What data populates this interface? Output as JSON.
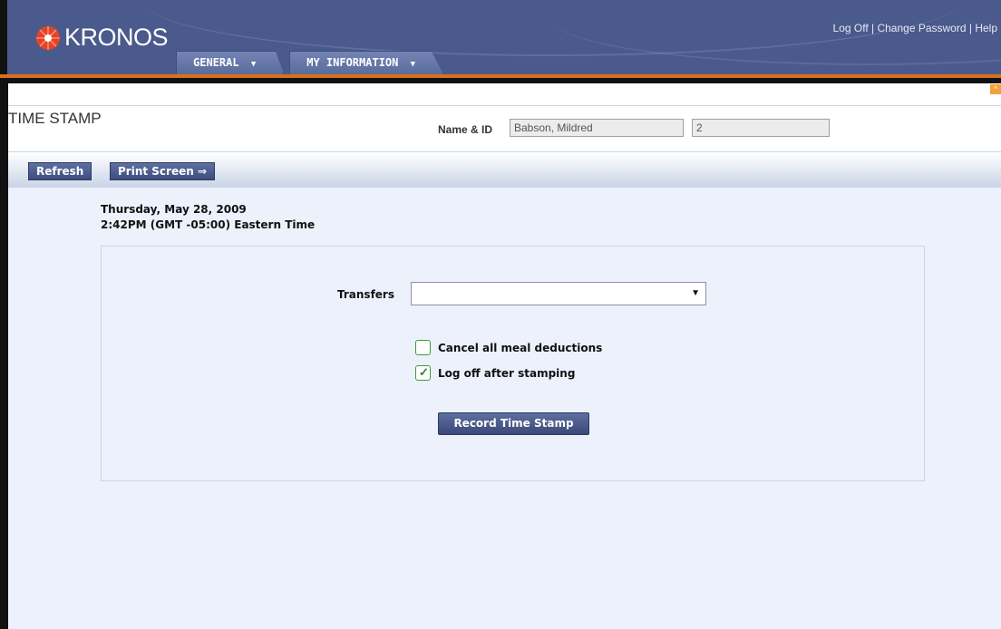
{
  "header": {
    "logo_text": "KRONOS",
    "links": [
      "Log Off",
      "Change Password",
      "Help"
    ],
    "tabs": [
      {
        "label": "GENERAL"
      },
      {
        "label": "MY INFORMATION"
      }
    ]
  },
  "page": {
    "title": "TIME STAMP",
    "name_label": "Name & ID",
    "name_value": "Babson, Mildred",
    "id_value": "2"
  },
  "toolbar": {
    "refresh_label": "Refresh",
    "print_label": "Print Screen ⇒"
  },
  "stamp": {
    "date": "Thursday, May 28, 2009",
    "time": "2:42PM (GMT -05:00) Eastern Time",
    "transfers_label": "Transfers",
    "transfers_value": "",
    "cancel_meal_label": "Cancel all meal deductions",
    "cancel_meal_checked": false,
    "logoff_label": "Log off after stamping",
    "logoff_checked": true,
    "record_button": "Record Time Stamp"
  },
  "colors": {
    "header_bg": "#4a5a8c",
    "accent_orange": "#d9701c",
    "panel_bg": "#ecf1fb",
    "button_bg": "#3e4d80"
  }
}
